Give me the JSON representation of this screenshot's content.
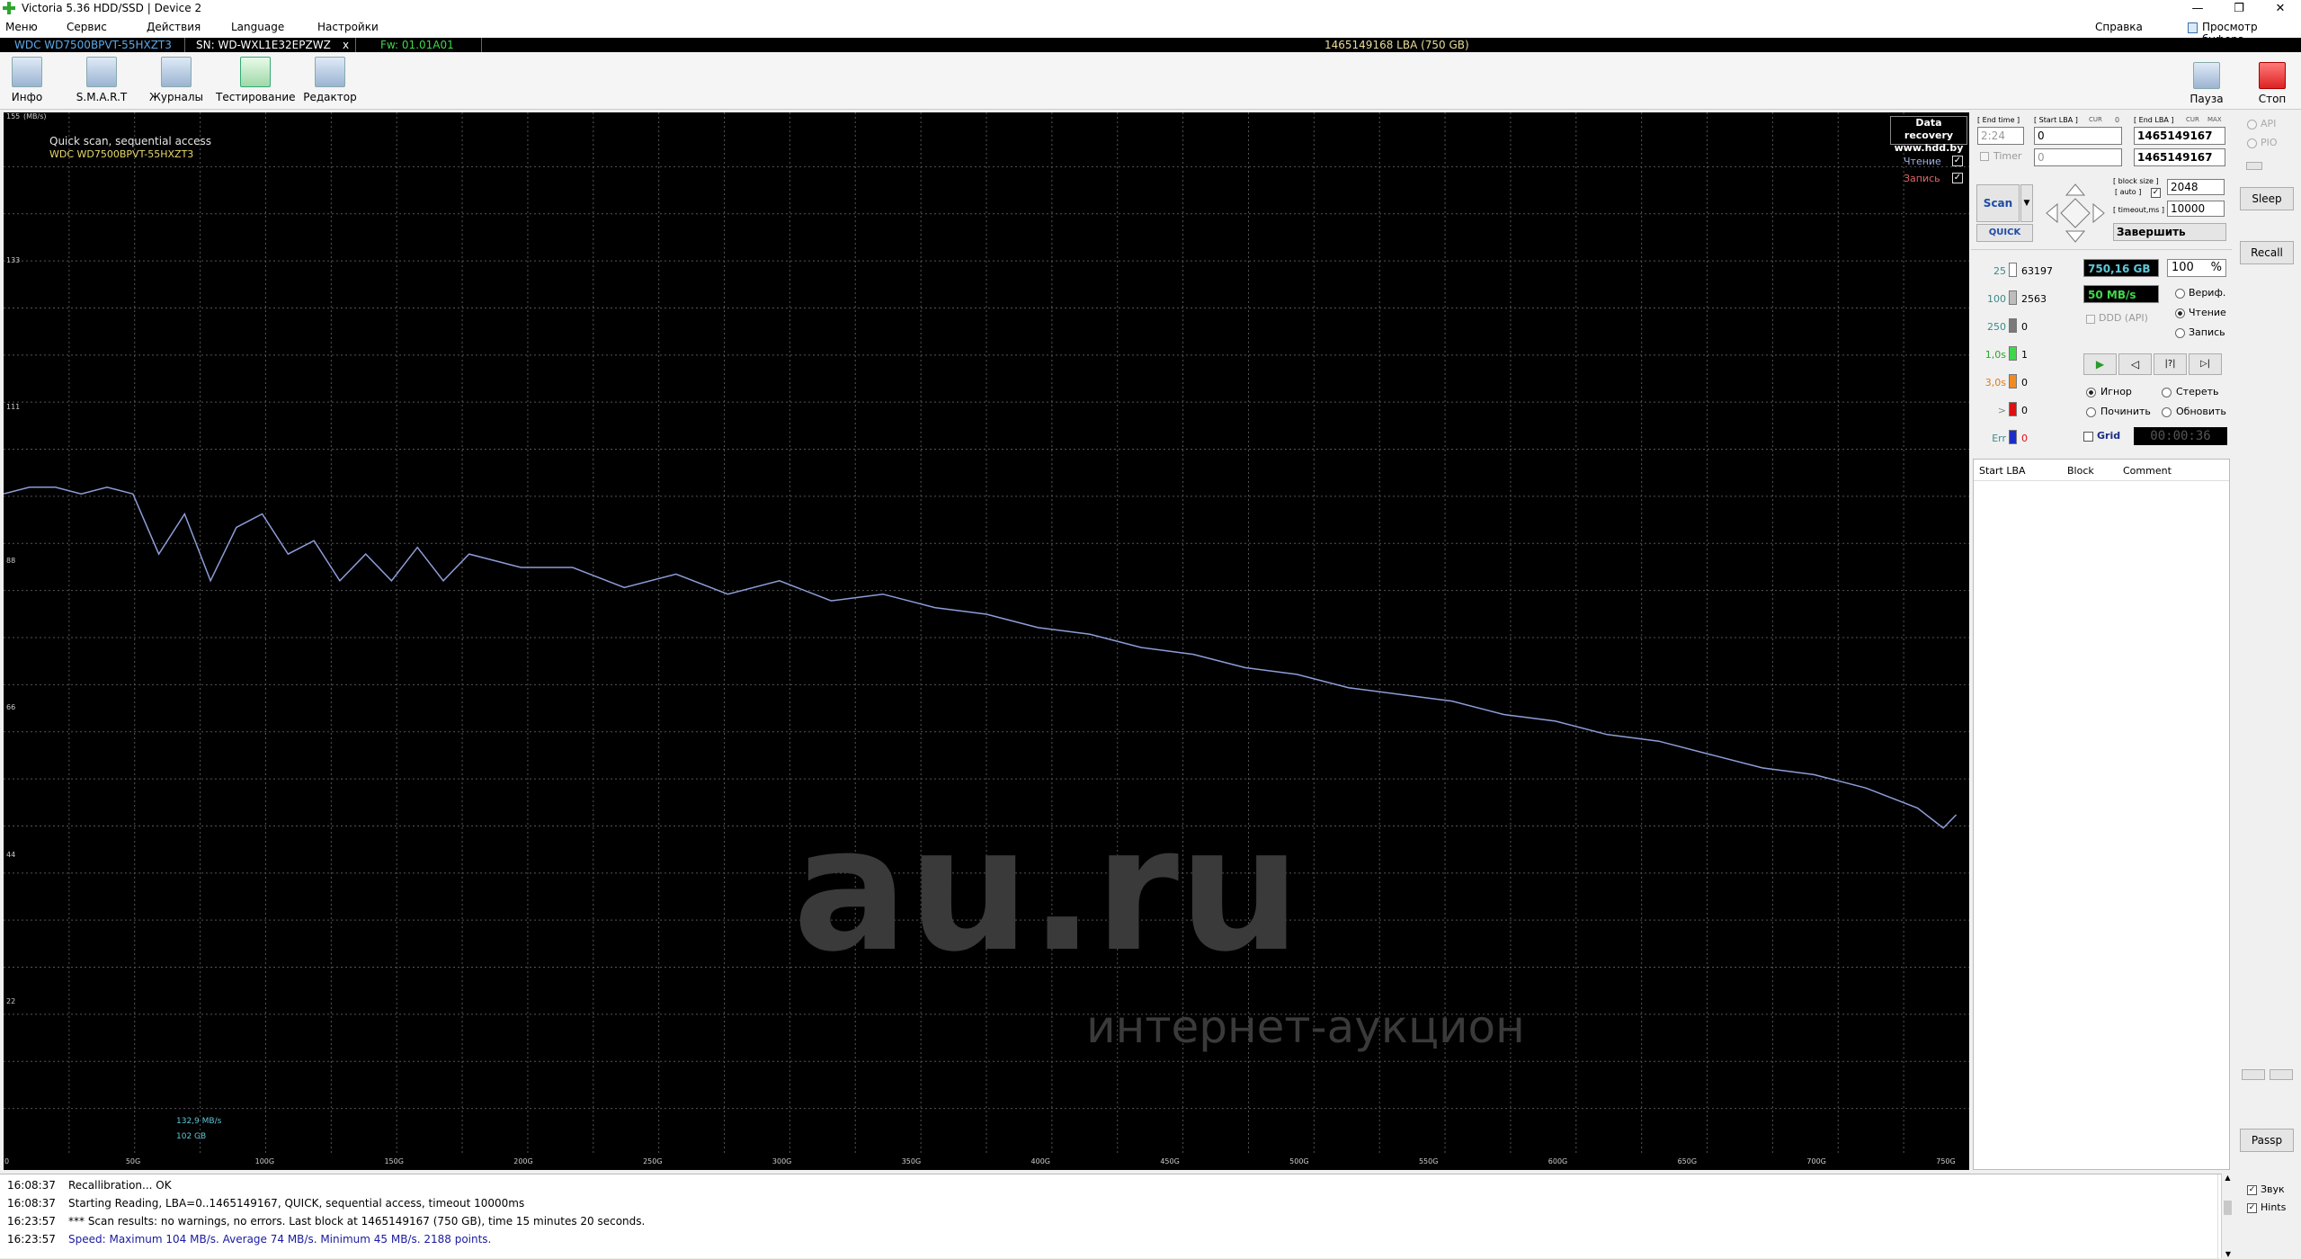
{
  "window": {
    "title": "Victoria 5.36 HDD/SSD | Device 2",
    "controls": [
      "—",
      "❐",
      "✕"
    ]
  },
  "menu": {
    "items": [
      "Меню",
      "Сервис",
      "Действия",
      "Language",
      "Настройки"
    ],
    "help": "Справка",
    "clipboard": "Просмотр буфера"
  },
  "infobar": {
    "model": "WDC WD7500BPVT-55HXZT3",
    "serial": "SN: WD-WXL1E32EPZWZ",
    "close_mark": "x",
    "firmware": "Fw: 01.01A01",
    "capacity": "1465149168 LBA (750 GB)"
  },
  "toolbar": {
    "buttons": [
      "Инфо",
      "S.M.A.R.T",
      "Журналы",
      "Тестирование",
      "Редактор"
    ],
    "pause": "Пауза",
    "stop": "Стоп"
  },
  "graph": {
    "title": "Quick scan, sequential access",
    "drive": "WDC WD7500BPVT-55HXZT3",
    "unit": "(MB/s)",
    "badge_line1": "Data recovery",
    "badge_line2": "www.hdd.by",
    "read_label": "Чтение",
    "write_label": "Запись",
    "cursor_speed": "132,9 MB/s",
    "cursor_pos": "102 GB",
    "watermark_big": "au.ru",
    "watermark_small": "интернет-аукцион"
  },
  "chart_data": {
    "type": "line",
    "ylabel": "(MB/s)",
    "ylim": [
      0,
      155
    ],
    "yticks": [
      155,
      133,
      111,
      88,
      66,
      44,
      22
    ],
    "xlim": [
      0,
      760
    ],
    "xticks": [
      "0",
      "50G",
      "100G",
      "150G",
      "200G",
      "250G",
      "300G",
      "350G",
      "400G",
      "450G",
      "500G",
      "550G",
      "600G",
      "650G",
      "700G",
      "750G"
    ],
    "grid": true,
    "series": [
      {
        "name": "Чтение",
        "color": "#8d9dd8",
        "x": [
          0,
          10,
          20,
          30,
          40,
          50,
          60,
          70,
          80,
          90,
          100,
          110,
          120,
          130,
          140,
          150,
          160,
          170,
          180,
          200,
          220,
          240,
          260,
          280,
          300,
          320,
          340,
          360,
          380,
          400,
          420,
          440,
          460,
          480,
          500,
          520,
          540,
          560,
          580,
          600,
          620,
          640,
          660,
          680,
          700,
          720,
          740,
          750,
          755
        ],
        "y": [
          99,
          100,
          100,
          99,
          100,
          99,
          90,
          96,
          86,
          94,
          96,
          90,
          92,
          86,
          90,
          86,
          91,
          86,
          90,
          88,
          88,
          85,
          87,
          84,
          86,
          83,
          84,
          82,
          81,
          79,
          78,
          76,
          75,
          73,
          72,
          70,
          69,
          68,
          66,
          65,
          63,
          62,
          60,
          58,
          57,
          55,
          52,
          49,
          51
        ]
      }
    ]
  },
  "rpanel": {
    "end_time_label": "[ End time ]",
    "end_time_value": "2:24",
    "timer_label": "Timer",
    "timer_value": "0",
    "start_lba_label": "[ Start LBA ]",
    "cur_label": "CUR",
    "cur_value": "0",
    "start_lba_value": "0",
    "start_lba_value2": "0",
    "end_lba_label": "[ End LBA ]",
    "cur2_label": "CUR",
    "max_label": "MAX",
    "end_lba_value": "1465149167",
    "end_lba_value2": "1465149167",
    "scan_label": "Scan",
    "quick_label": "QUICK",
    "block_size_label": "[ block size ]",
    "auto_label": "[ auto ]",
    "block_size_value": "2048",
    "timeout_label": "[ timeout,ms ]",
    "timeout_value": "10000",
    "finish_label": "Завершить",
    "counters": [
      {
        "label": "25",
        "value": "63197",
        "color": "#ffffff",
        "label_color": "#3a8a8a"
      },
      {
        "label": "100",
        "value": "2563",
        "color": "#bdbdbd",
        "label_color": "#3a8a8a"
      },
      {
        "label": "250",
        "value": "0",
        "color": "#7a7a7a",
        "label_color": "#3a8a8a"
      },
      {
        "label": "1,0s",
        "value": "1",
        "color": "#3fd84a",
        "label_color": "#27a827"
      },
      {
        "label": "3,0s",
        "value": "0",
        "color": "#f08a22",
        "label_color": "#e07a12"
      },
      {
        "label": ">",
        "value": "0",
        "color": "#e01010",
        "label_color": "#888888"
      },
      {
        "label": "Err",
        "value": "0",
        "color": "#1c2cc8",
        "label_color": "#3a8a8a"
      }
    ],
    "size_display": "750,16 GB",
    "percent_display": "100",
    "percent_sign": "%",
    "speed_display": "50 MB/s",
    "ddd_label": "DDD (API)",
    "mode_verify": "Вериф.",
    "mode_read": "Чтение",
    "mode_write": "Запись",
    "act_ignore": "Игнор",
    "act_erase": "Стереть",
    "act_repair": "Починить",
    "act_refresh": "Обновить",
    "grid_label": "Grid",
    "clock": "00:00:36",
    "table_headers": [
      "Start LBA",
      "Block",
      "Comment"
    ]
  },
  "farright": {
    "api": "API",
    "pio": "PIO",
    "sleep": "Sleep",
    "recall": "Recall",
    "passp": "Passp",
    "sound": "Звук",
    "hints": "Hints"
  },
  "log": [
    {
      "time": "16:08:37",
      "msg": "Recallibration... OK",
      "color": "#000000"
    },
    {
      "time": "16:08:37",
      "msg": "Starting Reading, LBA=0..1465149167, QUICK, sequential access, timeout 10000ms",
      "color": "#000000"
    },
    {
      "time": "16:23:57",
      "msg": "*** Scan results: no warnings, no errors. Last block at 1465149167 (750 GB), time 15 minutes 20 seconds.",
      "color": "#000000"
    },
    {
      "time": "16:23:57",
      "msg": "Speed: Maximum 104 MB/s. Average 74 MB/s. Minimum 45 MB/s. 2188 points.",
      "color": "#1a1aa0"
    }
  ]
}
